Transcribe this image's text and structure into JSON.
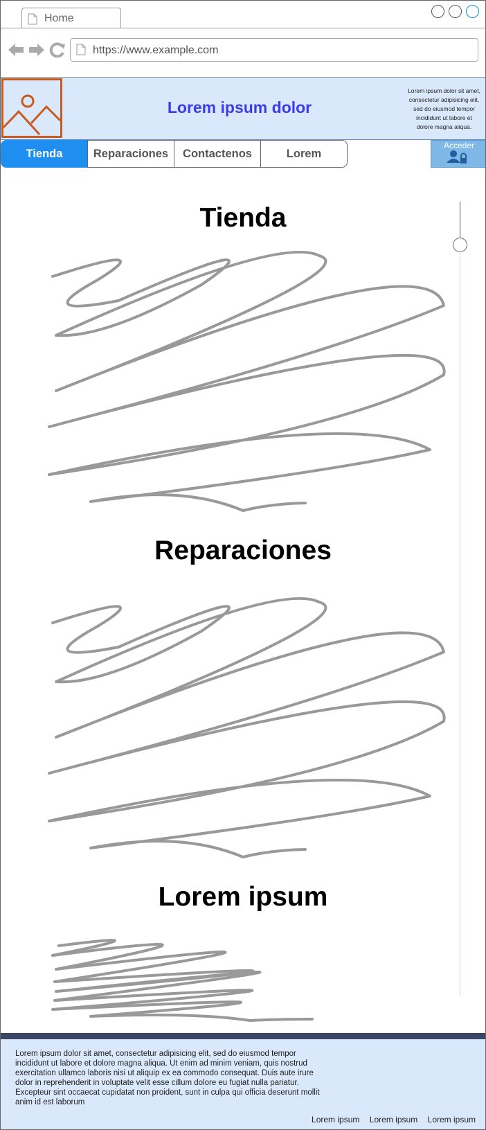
{
  "browser": {
    "tab_title": "Home",
    "url": "https://www.example.com"
  },
  "header": {
    "title": "Lorem ipsum dolor",
    "blurb_lines": [
      "Lorem ipsum dolor sit amet,",
      "consectetur adipisicing elit,",
      "sed do eiusmod tempor",
      "incididunt ut labore et",
      "dolore magna aliqua."
    ],
    "logo_icon": "image-icon"
  },
  "menu": {
    "items": [
      {
        "label": "Tienda"
      },
      {
        "label": "Reparaciones"
      },
      {
        "label": "Contactenos"
      },
      {
        "label": "Lorem"
      }
    ],
    "login_label": "Acceder",
    "login_icon": "user-lock-icon"
  },
  "sections": [
    {
      "title": "Tienda"
    },
    {
      "title": "Reparaciones"
    },
    {
      "title": "Lorem ipsum"
    }
  ],
  "footer": {
    "text_lines": [
      "Lorem ipsum dolor sit amet, consectetur adipisicing elit, sed do eiusmod tempor",
      "incididunt ut labore et dolore magna aliqua. Ut enim ad minim veniam, quis nostrud",
      "exercitation ullamco laboris nisi ut aliquip ex ea commodo consequat. Duis aute irure",
      "dolor in reprehenderit in voluptate velit esse cillum dolore eu fugiat nulla pariatur.",
      "Excepteur sint occaecat cupidatat non proident, sunt in culpa qui officia deserunt mollit",
      "anim id est laborum"
    ],
    "links": [
      "Lorem ipsum",
      "Lorem ipsum",
      "Lorem ipsum"
    ]
  },
  "colors": {
    "header_bg": "#dae8fc",
    "title_blue": "#3b3bef",
    "menu_active": "#1f8ef1",
    "logo_orange": "#c95a1e",
    "footer_bar": "#3b4565",
    "scribble_gray": "#999999"
  }
}
